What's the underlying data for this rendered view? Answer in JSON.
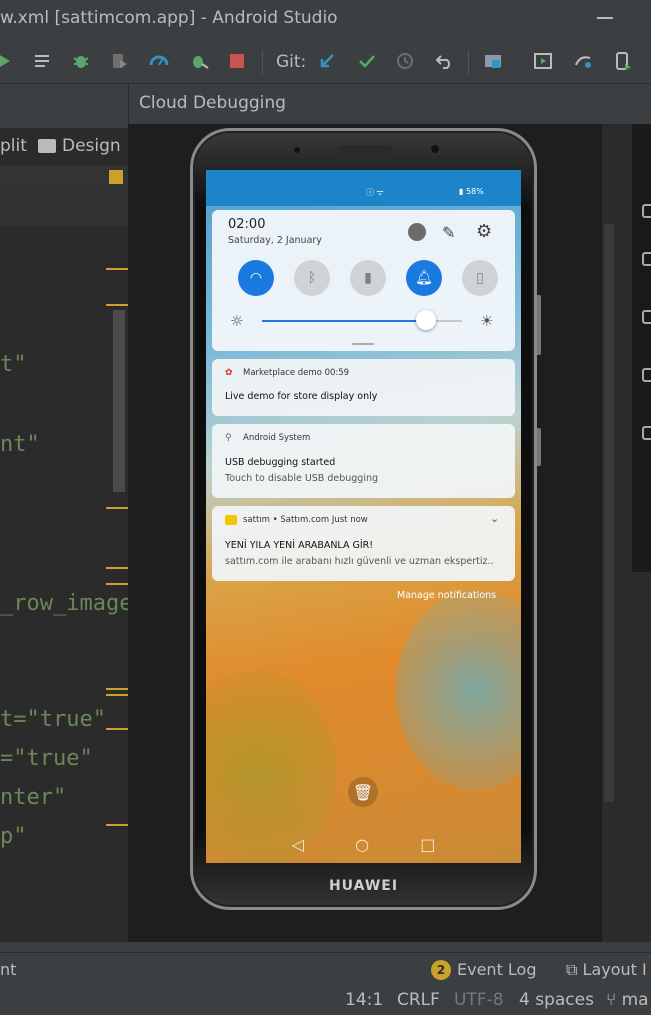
{
  "window": {
    "title": "w.xml [sattimcom.app] - Android Studio"
  },
  "toolbar": {
    "git_label": "Git:"
  },
  "editor": {
    "split_label": "plit",
    "design_label": "Design",
    "code_lines": [
      {
        "text": "t\""
      },
      {
        "text": "nt\""
      },
      {
        "text": "_row_image"
      },
      {
        "text": "t=\"true\""
      },
      {
        "text": "=\"true\""
      },
      {
        "text": "nter\""
      },
      {
        "text": "p\""
      }
    ]
  },
  "cloud_debugging": {
    "title": "Cloud Debugging"
  },
  "phone": {
    "brand": "HUAWEI",
    "statusbar": {
      "left_icons": "ⓘ ᯤ",
      "battery": "58%"
    },
    "quick_settings": {
      "time": "02:00",
      "date": "Saturday, 2 January",
      "brightness": 0.82,
      "tiles": [
        {
          "name": "wifi",
          "on": true
        },
        {
          "name": "bluetooth",
          "on": false
        },
        {
          "name": "flashlight",
          "on": false
        },
        {
          "name": "sound",
          "on": true
        },
        {
          "name": "vibrate",
          "on": false
        }
      ]
    },
    "notifications": [
      {
        "app": "Marketplace demo  00:59",
        "title": "Live demo for store display only",
        "body": ""
      },
      {
        "app": "Android System",
        "title": "USB debugging started",
        "body": "Touch to disable USB debugging"
      },
      {
        "app": "sattım  •  Sattım.com  Just now",
        "title": "YENİ YILA YENİ ARABANLA GİR!",
        "body": "sattım.com ile arabanı hızlı güvenli ve uzman ekspertiz.."
      }
    ],
    "manage_label": "Manage notifications"
  },
  "bottom": {
    "left_text": "nt",
    "event_count": "2",
    "event_log": "Event Log",
    "layout_inspector": "Layout I",
    "position": "14:1",
    "line_sep": "CRLF",
    "encoding": "UTF-8",
    "indent": "4 spaces",
    "branch": "ma"
  }
}
